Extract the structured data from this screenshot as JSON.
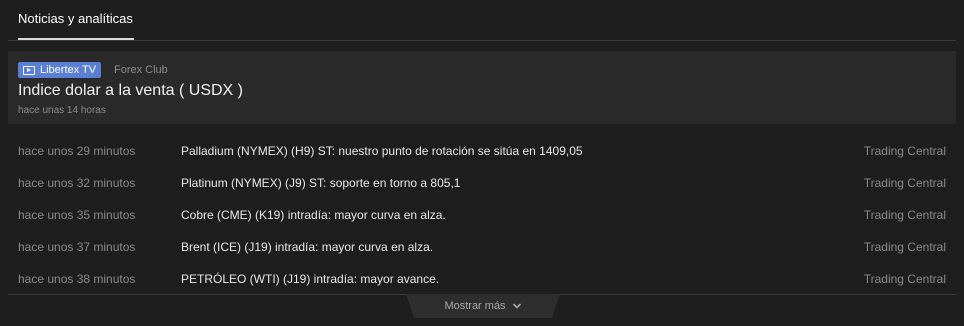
{
  "tabs": [
    {
      "label": "Noticias y analíticas",
      "active": true
    }
  ],
  "featured": {
    "badge_icon": "play-icon",
    "badge_label": "Libertex TV",
    "badge_color": "#5b7fd6",
    "source": "Forex Club",
    "headline": "Indice dolar a la venta ( USDX )",
    "time": "hace unas 14 horas"
  },
  "news": [
    {
      "time": "hace unos 29 minutos",
      "title": "Palladium (NYMEX) (H9) ST: nuestro punto de rotación se sitúa en 1409,05",
      "provider": "Trading Central"
    },
    {
      "time": "hace unos 32 minutos",
      "title": "Platinum (NYMEX) (J9) ST: soporte en torno a 805,1",
      "provider": "Trading Central"
    },
    {
      "time": "hace unos 35 minutos",
      "title": "Cobre (CME) (K19) intradía: mayor curva en alza.",
      "provider": "Trading Central"
    },
    {
      "time": "hace unos 37 minutos",
      "title": "Brent (ICE) (J19) intradía: mayor curva en alza.",
      "provider": "Trading Central"
    },
    {
      "time": "hace unos 38 minutos",
      "title": "PETRÓLEO (WTI) (J19) intradía: mayor avance.",
      "provider": "Trading Central"
    }
  ],
  "show_more": {
    "label": "Mostrar más",
    "icon": "chevron-down-icon"
  }
}
